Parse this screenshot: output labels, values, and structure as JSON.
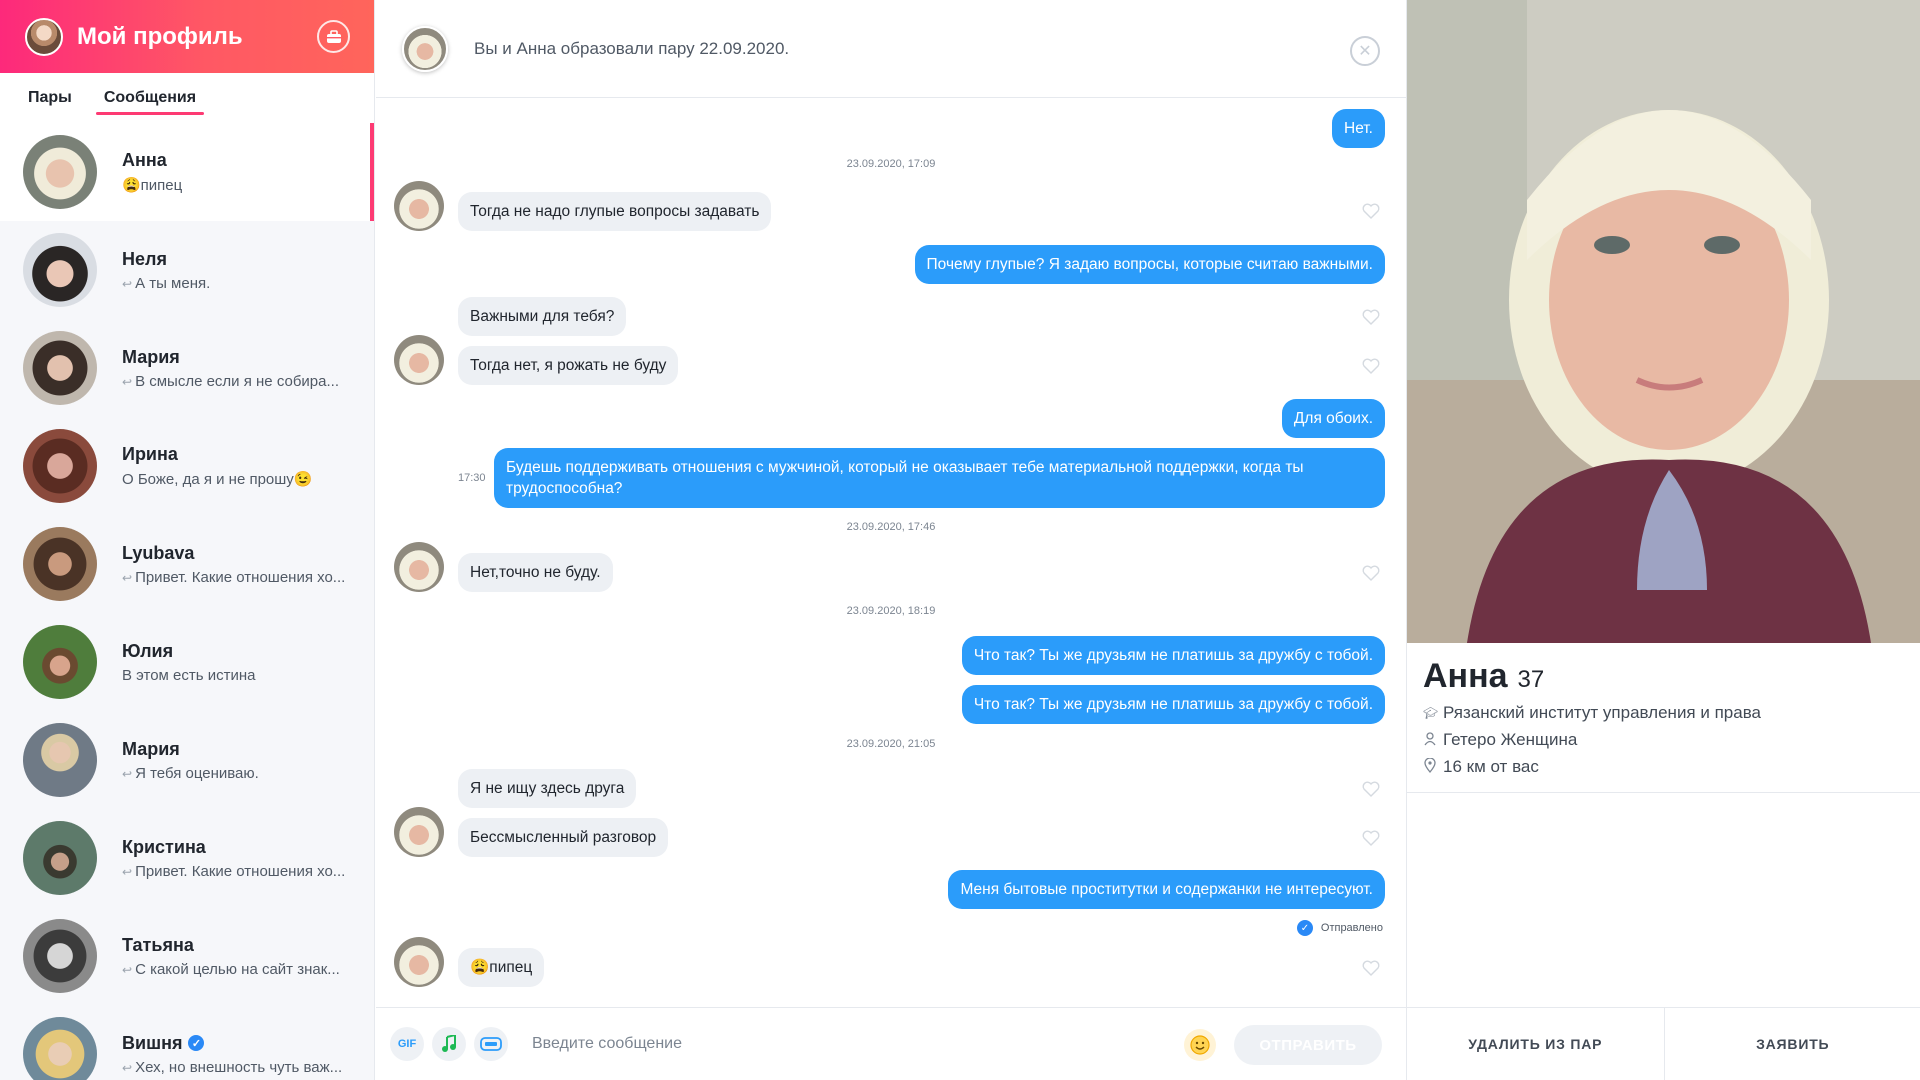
{
  "sidebar": {
    "title": "Мой профиль",
    "tabs": [
      {
        "label": "Пары"
      },
      {
        "label": "Сообщения"
      }
    ],
    "matches": [
      {
        "name": "Анна",
        "preview": "😩пипец",
        "reply": false,
        "verified": false
      },
      {
        "name": "Неля",
        "preview": "А ты меня.",
        "reply": true,
        "verified": false
      },
      {
        "name": "Мария",
        "preview": "В смысле если я не собира...",
        "reply": true,
        "verified": false
      },
      {
        "name": "Ирина",
        "preview": "О Боже, да я и не прошу😉",
        "reply": false,
        "verified": false
      },
      {
        "name": "Lyubava",
        "preview": "Привет. Какие отношения хо...",
        "reply": true,
        "verified": false
      },
      {
        "name": "Юлия",
        "preview": "В этом есть истина",
        "reply": false,
        "verified": false
      },
      {
        "name": "Мария",
        "preview": "Я тебя оцениваю.",
        "reply": true,
        "verified": false
      },
      {
        "name": "Кристина",
        "preview": "Привет. Какие отношения хо...",
        "reply": true,
        "verified": false
      },
      {
        "name": "Татьяна",
        "preview": "С какой целью на сайт знак...",
        "reply": true,
        "verified": false
      },
      {
        "name": "Вишня",
        "preview": "Хех, но внешность чуть важ...",
        "reply": true,
        "verified": true
      }
    ]
  },
  "chat": {
    "header_text": "Вы и Анна образовали пару 22.09.2020.",
    "messages": {
      "m1": "Нет.",
      "s1": "23.09.2020, 17:09",
      "m2": "Тогда не надо глупые вопросы задавать",
      "m3": "Почему глупые? Я задаю вопросы, которые считаю важными.",
      "m4": "Важными для тебя?",
      "m5": "Тогда нет, я рожать не буду",
      "m6": "Для обоих.",
      "t1": "17:30",
      "m7": "Будешь поддерживать отношения с мужчиной, который не оказывает тебе материальной поддержки, когда ты трудоспособна?",
      "s2": "23.09.2020, 17:46",
      "m8": "Нет,точно не буду.",
      "s3": "23.09.2020, 18:19",
      "m9": "Что так? Ты же друзьям не платишь за дружбу с тобой.",
      "m10": "Что так? Ты же друзьям не платишь за дружбу с тобой.",
      "s4": "23.09.2020, 21:05",
      "m11": "Я не ищу здесь друга",
      "m12": "Бессмысленный разговор",
      "m13": "Меня бытовые проститутки и содержанки не интересуют.",
      "status": "Отправлено",
      "m14": "😩пипец"
    },
    "composer": {
      "gif": "GIF",
      "placeholder": "Введите сообщение",
      "send": "ОТПРАВИТЬ"
    }
  },
  "profile": {
    "name": "Анна",
    "age": "37",
    "school": "Рязанский институт управления и права",
    "orientation": "Гетеро Женщина",
    "distance": "16 км от вас",
    "actions": {
      "unmatch": "УДАЛИТЬ ИЗ ПАР",
      "report": "ЗАЯВИТЬ"
    }
  },
  "colors": {
    "accent": "#fd3a73",
    "outgoing": "#2b9cfa",
    "incoming": "#edf0f4"
  }
}
